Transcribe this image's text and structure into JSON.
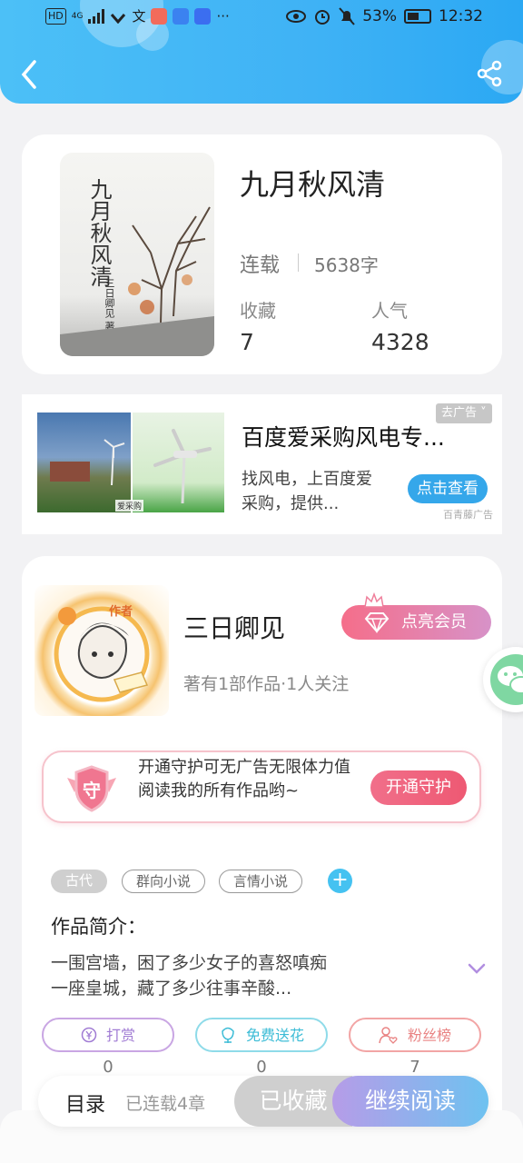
{
  "status_bar": {
    "left_icons": [
      "HD",
      "4G",
      "signal-icon",
      "wifi-icon",
      "app-icon-1",
      "app-icon-2",
      "app-icon-3",
      "app-icon-4",
      "more-icon"
    ],
    "more_label": "···",
    "battery": "53%",
    "time": "12:32"
  },
  "book": {
    "title": "九月秋风清",
    "cover_title": "九月秋风清",
    "cover_author": "三日卿见 著",
    "status": "连载",
    "word_count": "5638字",
    "favorites_label": "收藏",
    "favorites_value": "7",
    "popularity_label": "人气",
    "popularity_value": "4328"
  },
  "ad": {
    "title": "百度爱采购风电专...",
    "description": "找风电，上百度爱采购，提供...",
    "close_tag": "去广告 ˅",
    "button": "点击查看",
    "source": "百青藤广告",
    "image_watermark": "爱采购"
  },
  "author": {
    "avatar_tag": "作者",
    "name": "三日卿见",
    "meta": "著有1部作品·1人关注",
    "vip_button": "点亮会员"
  },
  "guard": {
    "text": "开通守护可无广告无限体力值阅读我的所有作品哟~",
    "button": "开通守护",
    "emblem_char": "守"
  },
  "tags": [
    "古代",
    "群向小说",
    "言情小说"
  ],
  "intro": {
    "label": "作品简介：",
    "text": "一围宫墙，困了多少女子的喜怒嗔痴\n一座皇城，藏了多少往事辛酸..."
  },
  "actions": [
    {
      "label": "打赏",
      "count": "0"
    },
    {
      "label": "免费送花",
      "count": "0"
    },
    {
      "label": "粉丝榜",
      "count": "7"
    }
  ],
  "bottom_bar": {
    "toc": "目录",
    "toc_sub": "已连载4章",
    "collected": "已收藏",
    "continue": "继续阅读"
  },
  "colors": {
    "header": "#3fb2f5",
    "vip_gradient_start": "#f56e8a",
    "vip_gradient_end": "#d792c8",
    "ad_button": "#35a7ea",
    "tag_add": "#45c2f1"
  }
}
